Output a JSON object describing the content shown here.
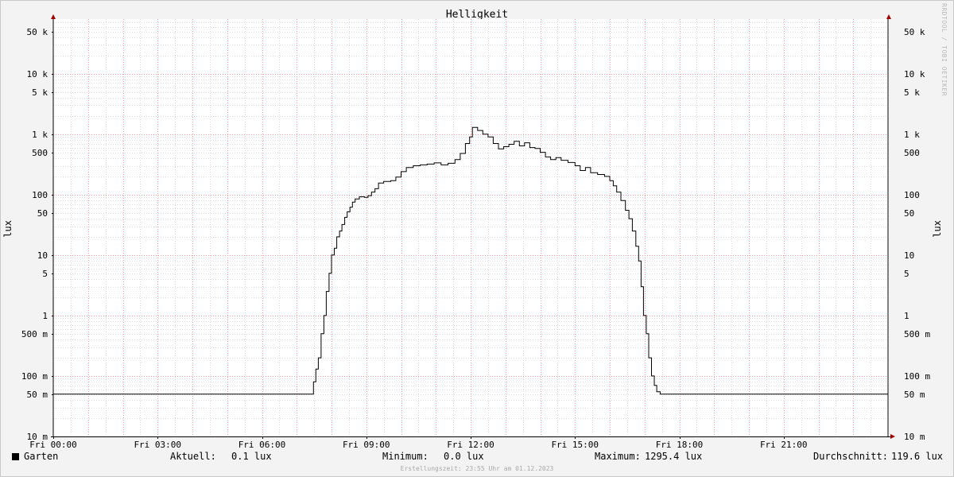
{
  "chart_data": {
    "type": "line",
    "title": "Helligkeit",
    "ylabel": "lux",
    "y_scale": "log",
    "ylim": [
      0.01,
      80000
    ],
    "y_ticks": [
      {
        "value": 50000,
        "label": "50 k"
      },
      {
        "value": 10000,
        "label": "10 k"
      },
      {
        "value": 5000,
        "label": "5 k"
      },
      {
        "value": 1000,
        "label": "1 k"
      },
      {
        "value": 500,
        "label": "500"
      },
      {
        "value": 100,
        "label": "100"
      },
      {
        "value": 50,
        "label": "50"
      },
      {
        "value": 10,
        "label": "10"
      },
      {
        "value": 5,
        "label": "5"
      },
      {
        "value": 1,
        "label": "1"
      },
      {
        "value": 0.5,
        "label": "500 m"
      },
      {
        "value": 0.1,
        "label": "100 m"
      },
      {
        "value": 0.05,
        "label": "50 m"
      },
      {
        "value": 0.01,
        "label": "10 m"
      }
    ],
    "x_unit": "hours",
    "xlim": [
      0,
      24
    ],
    "x_ticks": [
      {
        "value": 0,
        "label": "Fri 00:00"
      },
      {
        "value": 3,
        "label": "Fri 03:00"
      },
      {
        "value": 6,
        "label": "Fri 06:00"
      },
      {
        "value": 9,
        "label": "Fri 09:00"
      },
      {
        "value": 12,
        "label": "Fri 12:00"
      },
      {
        "value": 15,
        "label": "Fri 15:00"
      },
      {
        "value": 18,
        "label": "Fri 18:00"
      },
      {
        "value": 21,
        "label": "Fri 21:00"
      }
    ],
    "grid": true,
    "series": [
      {
        "name": "Garten",
        "color": "#000000",
        "points": [
          [
            0,
            0.05
          ],
          [
            7.45,
            0.05
          ],
          [
            7.48,
            0.08
          ],
          [
            7.55,
            0.13
          ],
          [
            7.62,
            0.2
          ],
          [
            7.7,
            0.5
          ],
          [
            7.78,
            1.0
          ],
          [
            7.85,
            2.5
          ],
          [
            7.93,
            5
          ],
          [
            8.0,
            10
          ],
          [
            8.08,
            13
          ],
          [
            8.15,
            20
          ],
          [
            8.23,
            25
          ],
          [
            8.3,
            32
          ],
          [
            8.38,
            42
          ],
          [
            8.45,
            52
          ],
          [
            8.53,
            62
          ],
          [
            8.6,
            75
          ],
          [
            8.68,
            85
          ],
          [
            8.8,
            92
          ],
          [
            8.95,
            90
          ],
          [
            9.05,
            96
          ],
          [
            9.15,
            110
          ],
          [
            9.25,
            125
          ],
          [
            9.35,
            155
          ],
          [
            9.5,
            165
          ],
          [
            9.7,
            170
          ],
          [
            9.85,
            195
          ],
          [
            10.0,
            240
          ],
          [
            10.15,
            280
          ],
          [
            10.35,
            300
          ],
          [
            10.55,
            310
          ],
          [
            10.75,
            320
          ],
          [
            10.95,
            335
          ],
          [
            11.15,
            310
          ],
          [
            11.35,
            330
          ],
          [
            11.55,
            380
          ],
          [
            11.7,
            480
          ],
          [
            11.85,
            700
          ],
          [
            11.97,
            900
          ],
          [
            12.05,
            1295
          ],
          [
            12.2,
            1150
          ],
          [
            12.35,
            1000
          ],
          [
            12.5,
            900
          ],
          [
            12.65,
            700
          ],
          [
            12.8,
            570
          ],
          [
            12.95,
            620
          ],
          [
            13.1,
            680
          ],
          [
            13.25,
            760
          ],
          [
            13.4,
            640
          ],
          [
            13.55,
            720
          ],
          [
            13.7,
            600
          ],
          [
            13.85,
            580
          ],
          [
            14.0,
            500
          ],
          [
            14.15,
            420
          ],
          [
            14.3,
            380
          ],
          [
            14.45,
            410
          ],
          [
            14.6,
            370
          ],
          [
            14.8,
            340
          ],
          [
            15.0,
            300
          ],
          [
            15.15,
            250
          ],
          [
            15.3,
            280
          ],
          [
            15.45,
            230
          ],
          [
            15.65,
            215
          ],
          [
            15.85,
            200
          ],
          [
            16.0,
            170
          ],
          [
            16.1,
            140
          ],
          [
            16.2,
            110
          ],
          [
            16.32,
            80
          ],
          [
            16.45,
            55
          ],
          [
            16.55,
            40
          ],
          [
            16.65,
            25
          ],
          [
            16.75,
            14
          ],
          [
            16.83,
            8
          ],
          [
            16.9,
            3
          ],
          [
            16.97,
            1.0
          ],
          [
            17.05,
            0.5
          ],
          [
            17.12,
            0.2
          ],
          [
            17.2,
            0.1
          ],
          [
            17.28,
            0.07
          ],
          [
            17.35,
            0.055
          ],
          [
            17.45,
            0.05
          ],
          [
            24,
            0.05
          ]
        ]
      }
    ]
  },
  "legend": {
    "series_label": "Garten",
    "current_label": "Aktuell:",
    "current_value": "0.1 lux",
    "min_label": "Minimum:",
    "min_value": "0.0 lux",
    "max_label": "Maximum:",
    "max_value": "1295.4 lux",
    "avg_label": "Durchschnitt:",
    "avg_value": "119.6 lux"
  },
  "watermark": "RRDTOOL / TOBI OETIKER",
  "created": "Erstellungszeit: 23:55 Uhr am 01.12.2023"
}
